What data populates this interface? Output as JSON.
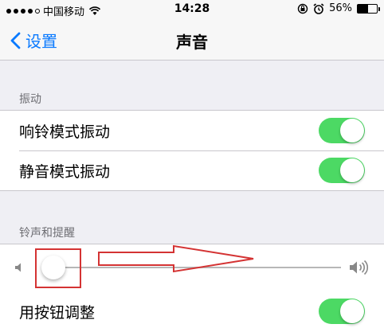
{
  "status_bar": {
    "carrier": "中国移动",
    "time": "14:28",
    "battery_percent": "56%",
    "battery_level": 0.56,
    "icons": [
      "signal-dots-icon",
      "wifi-icon",
      "rotation-lock-icon",
      "alarm-icon",
      "battery-icon"
    ]
  },
  "nav": {
    "back_label": "设置",
    "title": "声音"
  },
  "vibration": {
    "header": "振动",
    "items": [
      {
        "label": "响铃模式振动",
        "on": true
      },
      {
        "label": "静音模式振动",
        "on": true
      }
    ]
  },
  "ringer": {
    "header": "铃声和提醒",
    "volume_level": 0,
    "change_with_buttons": {
      "label": "用按钮调整",
      "on": true
    }
  },
  "colors": {
    "accent": "#0a7aff",
    "toggle_on": "#4cd964",
    "annotation": "#d43333"
  }
}
